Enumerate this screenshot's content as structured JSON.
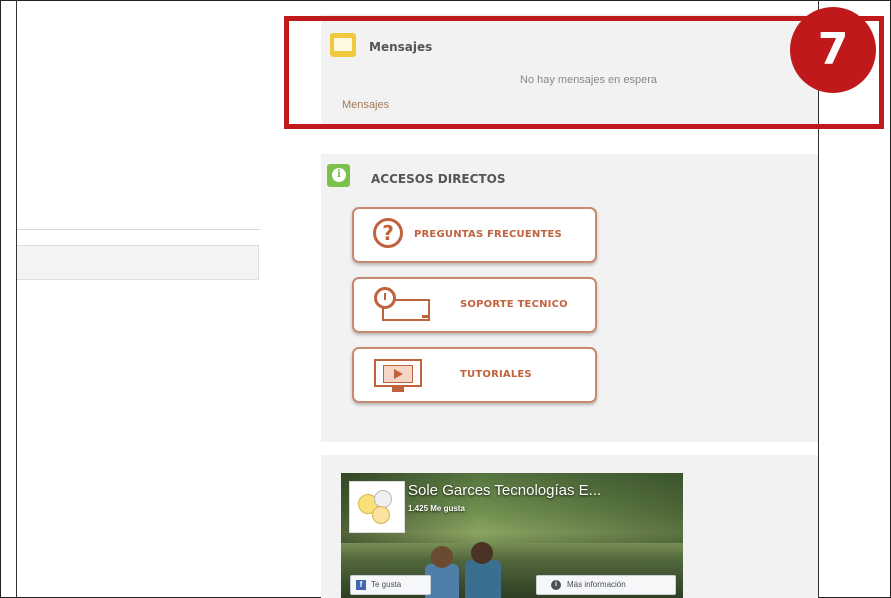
{
  "messages": {
    "title": "Mensajes",
    "empty_text": "No hay mensajes en espera",
    "link": "Mensajes",
    "icon": "envelope-icon",
    "icon_color": "#f0c93c"
  },
  "shortcuts": {
    "title": "ACCESOS DIRECTOS",
    "icon": "info-icon",
    "icon_color": "#7cc24a",
    "icon_glyph": "i",
    "buttons": [
      {
        "label": "PREGUNTAS FRECUENTES",
        "icon": "question-icon",
        "glyph": "?"
      },
      {
        "label": "SOPORTE  TECNICO",
        "icon": "clock-monitor-icon"
      },
      {
        "label": "TUTORIALES",
        "icon": "video-monitor-icon"
      }
    ],
    "accent_color": "#c0623e"
  },
  "facebook": {
    "page_name": "Sole Garces Tecnologías E...",
    "likes": "1.425 Me gusta",
    "like_button": "Te gusta",
    "like_glyph": "f",
    "more_button": "Más información",
    "more_glyph": "i"
  },
  "annotation": {
    "number": "7",
    "color": "#c0191c"
  }
}
